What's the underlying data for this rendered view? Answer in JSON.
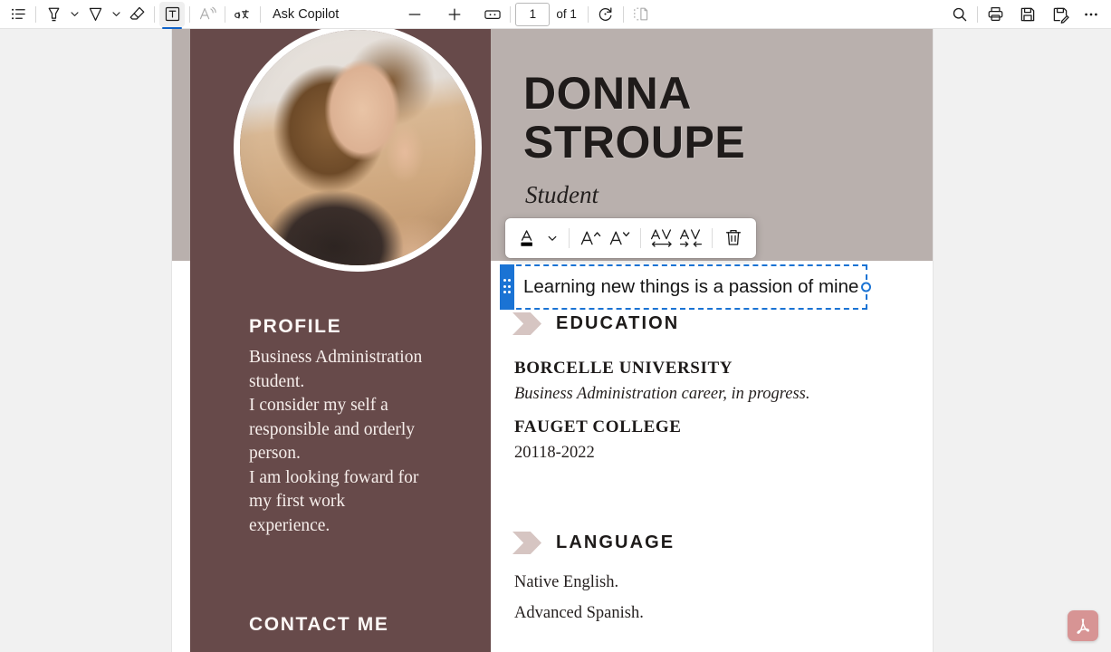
{
  "toolbar": {
    "items": [
      {
        "name": "list-view-icon",
        "label": "List view"
      },
      {
        "name": "highlighter-icon",
        "label": "Highlight"
      },
      {
        "name": "highlighter-chevron-icon",
        "label": "Highlight options"
      },
      {
        "name": "pen-icon",
        "label": "Draw"
      },
      {
        "name": "pen-chevron-icon",
        "label": "Draw options"
      },
      {
        "name": "eraser-icon",
        "label": "Erase"
      },
      {
        "name": "add-text-icon",
        "label": "Add text"
      },
      {
        "name": "read-aloud-icon",
        "label": "Read aloud"
      },
      {
        "name": "translate-icon",
        "label": "Translate"
      }
    ],
    "copilot_label": "Ask Copilot",
    "zoom_out_label": "Zoom out",
    "zoom_in_label": "Zoom in",
    "fit_page_label": "Fit to page",
    "page_number": "1",
    "page_of": "of 1",
    "rotate_label": "Rotate",
    "page_layout_label": "Page view",
    "search_label": "Search",
    "print_label": "Print",
    "save_label": "Save",
    "save_as_label": "Save as",
    "more_label": "More options"
  },
  "format_bar": {
    "items": [
      {
        "name": "font-color-button",
        "label": "Text color"
      },
      {
        "name": "font-color-chevron",
        "label": "Text color options"
      },
      {
        "name": "increase-font-size-button",
        "label": "Increase font size"
      },
      {
        "name": "decrease-font-size-button",
        "label": "Decrease font size"
      },
      {
        "name": "increase-spacing-button",
        "label": "Increase letter spacing"
      },
      {
        "name": "decrease-spacing-button",
        "label": "Decrease letter spacing"
      },
      {
        "name": "delete-textbox-button",
        "label": "Delete"
      }
    ],
    "current_color": "#000000"
  },
  "textbox": {
    "value_before_caret": "Learning new things is a pa",
    "value_after_caret": "ssion of mine",
    "full_value": "Learning new things is a passion of mine",
    "border_color": "#1a73d4"
  },
  "resume": {
    "name": "DONNA STROUPE",
    "role": "Student",
    "profile": {
      "title": "PROFILE",
      "body": "Business Administration student.\nI consider my self a responsible and orderly person.\nI am looking foward for my first work experience."
    },
    "contact": {
      "title": "CONTACT ME"
    },
    "education": {
      "title": "EDUCATION",
      "entries": [
        {
          "school": "BORCELLE UNIVERSITY",
          "detail": "Business Administration career, in progress.",
          "detail_style": "italic"
        },
        {
          "school": "FAUGET COLLEGE",
          "detail": "20118-2022",
          "detail_style": "plain"
        }
      ]
    },
    "language": {
      "title": "LANGUAGE",
      "lines": [
        "Native English.",
        "Advanced Spanish."
      ]
    },
    "colors": {
      "sidebar": "#674a4a",
      "header_band": "#b9b0ad",
      "accent_arrow": "#d6c5c2",
      "page": "#ffffff"
    }
  },
  "pdf_badge": {
    "name": "pdf-icon",
    "label": "PDF"
  }
}
